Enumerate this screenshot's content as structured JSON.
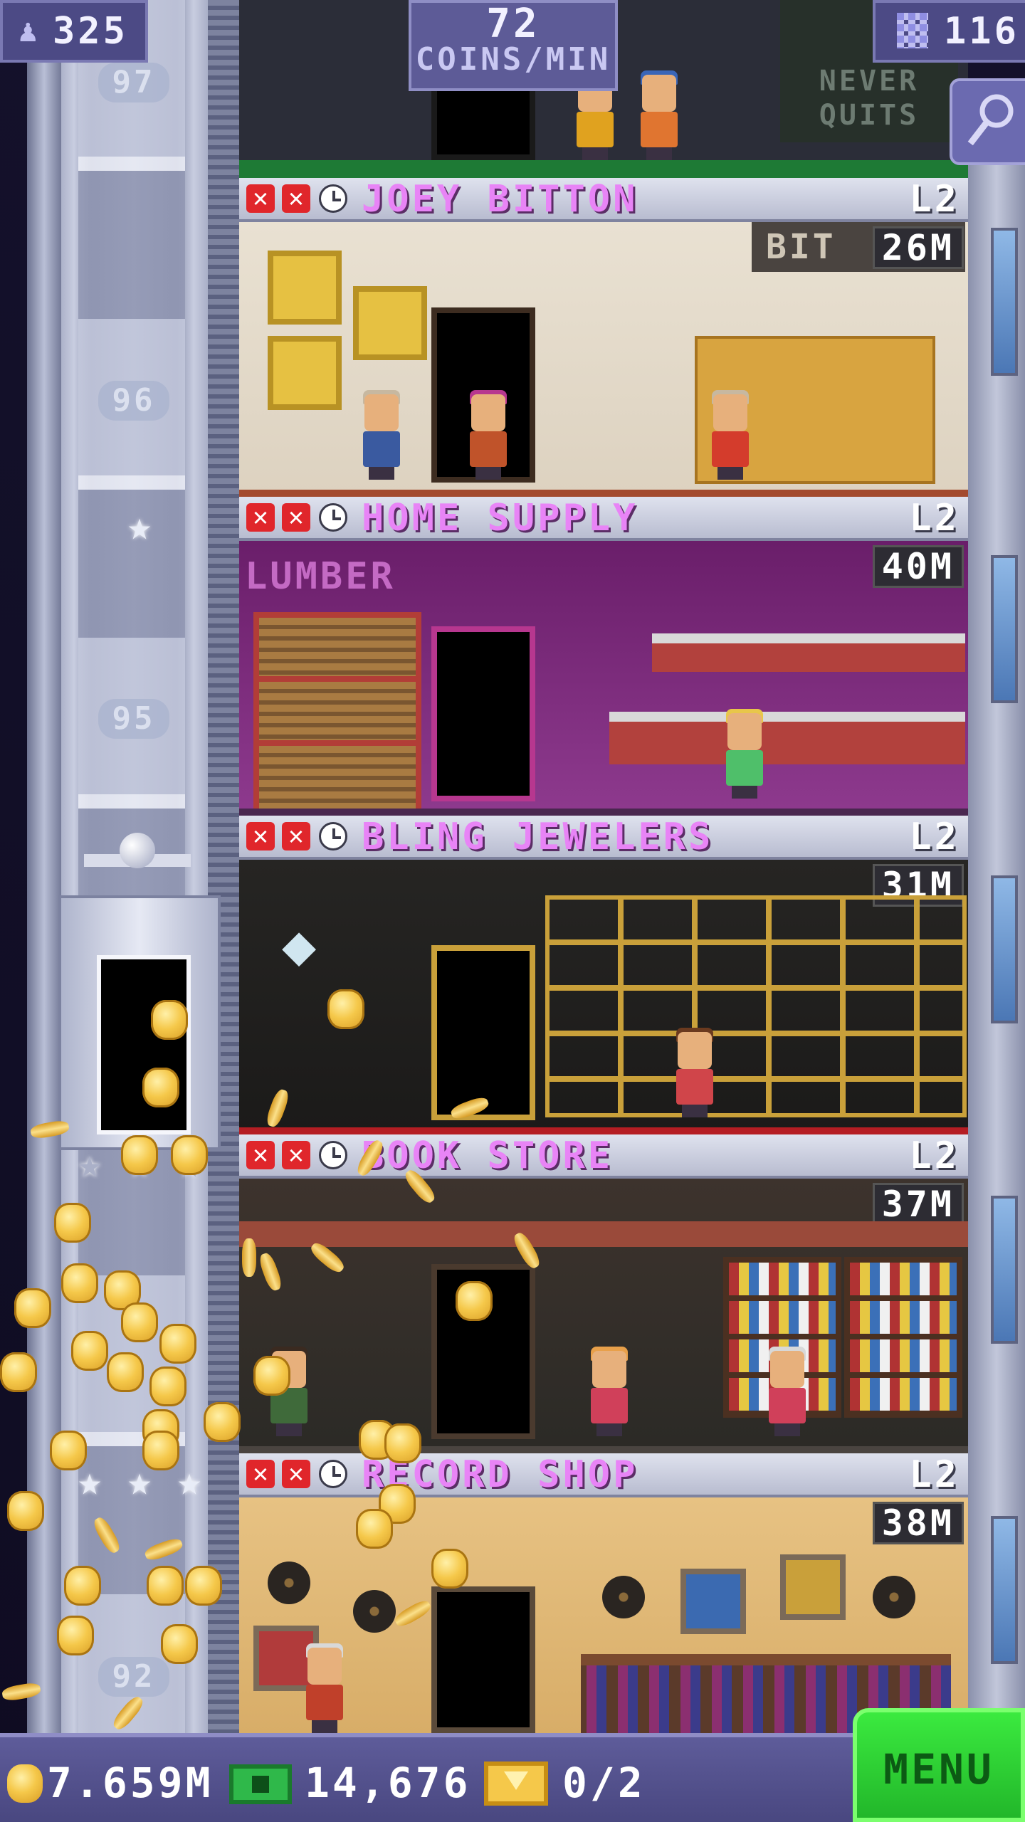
{
  "hud": {
    "population": "325",
    "coins_rate_value": "72",
    "coins_rate_unit": "COINS/MIN",
    "floors": "116"
  },
  "top_floor": {
    "sign_text": "NEVER QUITS"
  },
  "shaft": {
    "floor_numbers": [
      "97",
      "96",
      "95",
      "92"
    ]
  },
  "floors": [
    {
      "name": "JOEY BITTON",
      "level": "L2",
      "time": "26M",
      "sign": "BIT"
    },
    {
      "name": "HOME SUPPLY",
      "level": "L2",
      "time": "40M",
      "sign": "LUMBER"
    },
    {
      "name": "BLING JEWELERS",
      "level": "L2",
      "time": "31M"
    },
    {
      "name": "BOOK STORE",
      "level": "L2",
      "time": "37M"
    },
    {
      "name": "RECORD SHOP",
      "level": "L2",
      "time": "38M"
    }
  ],
  "bottom": {
    "coins": "7.659M",
    "bux": "14,676",
    "tickets": "0/2",
    "menu_label": "MENU"
  },
  "colors": {
    "hud_purple": "#4c4a85",
    "floor_name_pink": "#e884f6",
    "menu_green": "#3bea3f",
    "coin_gold": "#f5c84a",
    "status_red": "#e0262b"
  },
  "icons": {
    "population": "person-icon",
    "floors": "building-icon",
    "search": "magnifier-icon",
    "coins": "coin-icon",
    "bux": "bux-icon",
    "tickets": "ticket-icon"
  }
}
